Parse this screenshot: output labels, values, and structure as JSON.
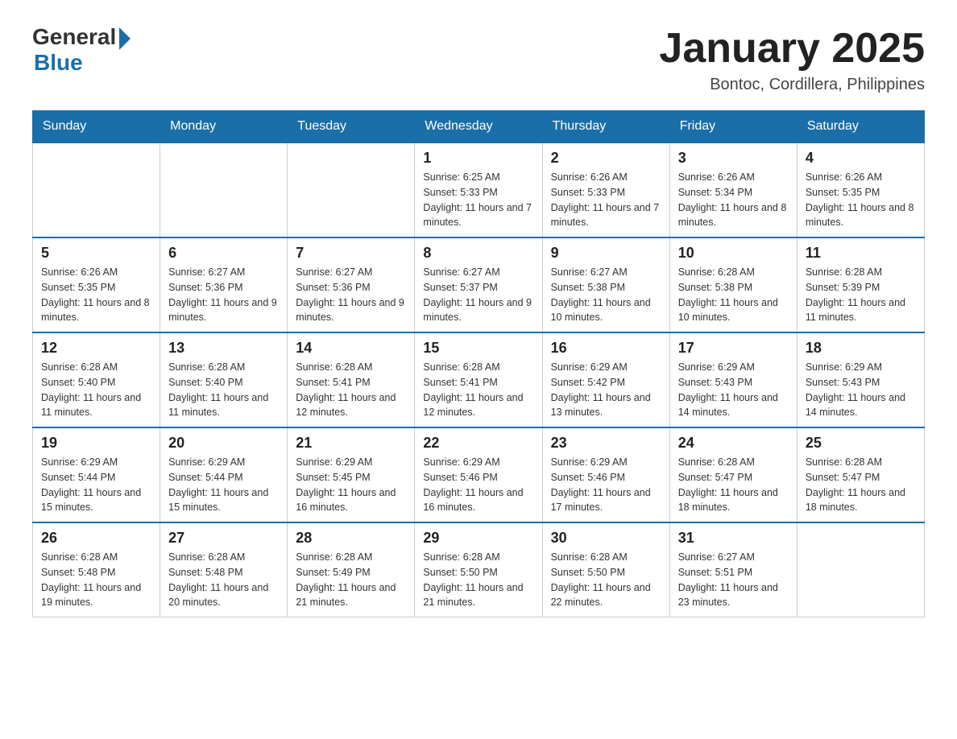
{
  "header": {
    "logo_general": "General",
    "logo_blue": "Blue",
    "month_title": "January 2025",
    "location": "Bontoc, Cordillera, Philippines"
  },
  "days_of_week": [
    "Sunday",
    "Monday",
    "Tuesday",
    "Wednesday",
    "Thursday",
    "Friday",
    "Saturday"
  ],
  "weeks": [
    {
      "days": [
        {
          "number": "",
          "info": ""
        },
        {
          "number": "",
          "info": ""
        },
        {
          "number": "",
          "info": ""
        },
        {
          "number": "1",
          "info": "Sunrise: 6:25 AM\nSunset: 5:33 PM\nDaylight: 11 hours and 7 minutes."
        },
        {
          "number": "2",
          "info": "Sunrise: 6:26 AM\nSunset: 5:33 PM\nDaylight: 11 hours and 7 minutes."
        },
        {
          "number": "3",
          "info": "Sunrise: 6:26 AM\nSunset: 5:34 PM\nDaylight: 11 hours and 8 minutes."
        },
        {
          "number": "4",
          "info": "Sunrise: 6:26 AM\nSunset: 5:35 PM\nDaylight: 11 hours and 8 minutes."
        }
      ]
    },
    {
      "days": [
        {
          "number": "5",
          "info": "Sunrise: 6:26 AM\nSunset: 5:35 PM\nDaylight: 11 hours and 8 minutes."
        },
        {
          "number": "6",
          "info": "Sunrise: 6:27 AM\nSunset: 5:36 PM\nDaylight: 11 hours and 9 minutes."
        },
        {
          "number": "7",
          "info": "Sunrise: 6:27 AM\nSunset: 5:36 PM\nDaylight: 11 hours and 9 minutes."
        },
        {
          "number": "8",
          "info": "Sunrise: 6:27 AM\nSunset: 5:37 PM\nDaylight: 11 hours and 9 minutes."
        },
        {
          "number": "9",
          "info": "Sunrise: 6:27 AM\nSunset: 5:38 PM\nDaylight: 11 hours and 10 minutes."
        },
        {
          "number": "10",
          "info": "Sunrise: 6:28 AM\nSunset: 5:38 PM\nDaylight: 11 hours and 10 minutes."
        },
        {
          "number": "11",
          "info": "Sunrise: 6:28 AM\nSunset: 5:39 PM\nDaylight: 11 hours and 11 minutes."
        }
      ]
    },
    {
      "days": [
        {
          "number": "12",
          "info": "Sunrise: 6:28 AM\nSunset: 5:40 PM\nDaylight: 11 hours and 11 minutes."
        },
        {
          "number": "13",
          "info": "Sunrise: 6:28 AM\nSunset: 5:40 PM\nDaylight: 11 hours and 11 minutes."
        },
        {
          "number": "14",
          "info": "Sunrise: 6:28 AM\nSunset: 5:41 PM\nDaylight: 11 hours and 12 minutes."
        },
        {
          "number": "15",
          "info": "Sunrise: 6:28 AM\nSunset: 5:41 PM\nDaylight: 11 hours and 12 minutes."
        },
        {
          "number": "16",
          "info": "Sunrise: 6:29 AM\nSunset: 5:42 PM\nDaylight: 11 hours and 13 minutes."
        },
        {
          "number": "17",
          "info": "Sunrise: 6:29 AM\nSunset: 5:43 PM\nDaylight: 11 hours and 14 minutes."
        },
        {
          "number": "18",
          "info": "Sunrise: 6:29 AM\nSunset: 5:43 PM\nDaylight: 11 hours and 14 minutes."
        }
      ]
    },
    {
      "days": [
        {
          "number": "19",
          "info": "Sunrise: 6:29 AM\nSunset: 5:44 PM\nDaylight: 11 hours and 15 minutes."
        },
        {
          "number": "20",
          "info": "Sunrise: 6:29 AM\nSunset: 5:44 PM\nDaylight: 11 hours and 15 minutes."
        },
        {
          "number": "21",
          "info": "Sunrise: 6:29 AM\nSunset: 5:45 PM\nDaylight: 11 hours and 16 minutes."
        },
        {
          "number": "22",
          "info": "Sunrise: 6:29 AM\nSunset: 5:46 PM\nDaylight: 11 hours and 16 minutes."
        },
        {
          "number": "23",
          "info": "Sunrise: 6:29 AM\nSunset: 5:46 PM\nDaylight: 11 hours and 17 minutes."
        },
        {
          "number": "24",
          "info": "Sunrise: 6:28 AM\nSunset: 5:47 PM\nDaylight: 11 hours and 18 minutes."
        },
        {
          "number": "25",
          "info": "Sunrise: 6:28 AM\nSunset: 5:47 PM\nDaylight: 11 hours and 18 minutes."
        }
      ]
    },
    {
      "days": [
        {
          "number": "26",
          "info": "Sunrise: 6:28 AM\nSunset: 5:48 PM\nDaylight: 11 hours and 19 minutes."
        },
        {
          "number": "27",
          "info": "Sunrise: 6:28 AM\nSunset: 5:48 PM\nDaylight: 11 hours and 20 minutes."
        },
        {
          "number": "28",
          "info": "Sunrise: 6:28 AM\nSunset: 5:49 PM\nDaylight: 11 hours and 21 minutes."
        },
        {
          "number": "29",
          "info": "Sunrise: 6:28 AM\nSunset: 5:50 PM\nDaylight: 11 hours and 21 minutes."
        },
        {
          "number": "30",
          "info": "Sunrise: 6:28 AM\nSunset: 5:50 PM\nDaylight: 11 hours and 22 minutes."
        },
        {
          "number": "31",
          "info": "Sunrise: 6:27 AM\nSunset: 5:51 PM\nDaylight: 11 hours and 23 minutes."
        },
        {
          "number": "",
          "info": ""
        }
      ]
    }
  ]
}
